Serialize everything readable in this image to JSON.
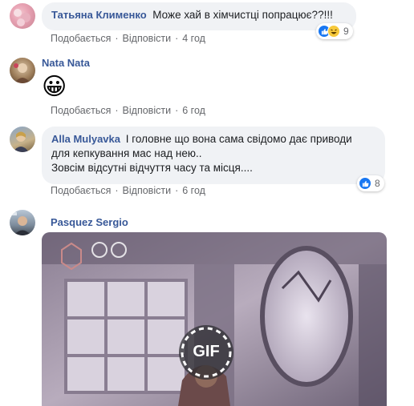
{
  "comments": [
    {
      "author": "Татьяна Клименко",
      "text": "Може хай в хімчистці попрацює??!!!",
      "actions": {
        "like": "Подобається",
        "reply": "Відповісти",
        "time": "4 год"
      },
      "reactions": {
        "count": "9",
        "icons": [
          "like-icon",
          "haha-icon"
        ]
      }
    },
    {
      "author": "Nata Nata",
      "emoji": "😀",
      "actions": {
        "like": "Подобається",
        "reply": "Відповісти",
        "time": "6 год"
      }
    },
    {
      "author": "Alla Mulyavka",
      "lines": [
        "І головне що вона сама свідомо дає приводи",
        "для кепкування мас над нею..",
        "Зовсім відсутні відчуття часу та місця...."
      ],
      "actions": {
        "like": "Подобається",
        "reply": "Відповісти",
        "time": "6 год"
      },
      "reactions": {
        "count": "8",
        "icons": [
          "like-icon"
        ]
      }
    },
    {
      "author": "Pasquez Sergio",
      "gif_label": "GIF"
    }
  ],
  "colors": {
    "author": "#385898",
    "meta": "#65676b",
    "bubble": "#f0f2f5",
    "like": "#1877f2"
  }
}
